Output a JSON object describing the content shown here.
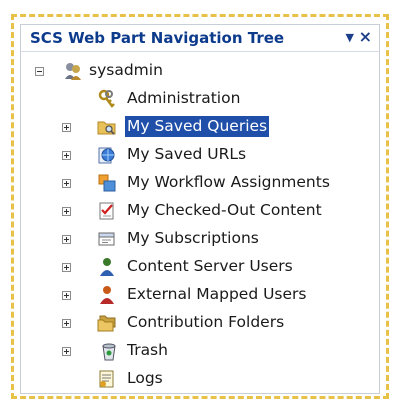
{
  "webpart": {
    "title": "SCS Web Part Navigation Tree",
    "menu_glyph": "▼",
    "close_glyph": "×"
  },
  "tree": {
    "root": {
      "label": "sysadmin",
      "icon": "user-admin-icon",
      "expanded": true
    },
    "items": [
      {
        "label": "Administration",
        "icon": "keys-icon",
        "expandable": false,
        "selected": false
      },
      {
        "label": "My Saved Queries",
        "icon": "folder-search-icon",
        "expandable": true,
        "selected": true
      },
      {
        "label": "My Saved URLs",
        "icon": "globe-link-icon",
        "expandable": true,
        "selected": false
      },
      {
        "label": "My Workflow Assignments",
        "icon": "workflow-icon",
        "expandable": true,
        "selected": false
      },
      {
        "label": "My Checked-Out Content",
        "icon": "checklist-icon",
        "expandable": true,
        "selected": false
      },
      {
        "label": "My Subscriptions",
        "icon": "subscription-icon",
        "expandable": true,
        "selected": false
      },
      {
        "label": "Content Server Users",
        "icon": "user-green-icon",
        "expandable": true,
        "selected": false
      },
      {
        "label": "External Mapped Users",
        "icon": "user-red-icon",
        "expandable": true,
        "selected": false
      },
      {
        "label": "Contribution Folders",
        "icon": "folders-icon",
        "expandable": true,
        "selected": false
      },
      {
        "label": "Trash",
        "icon": "trash-icon",
        "expandable": true,
        "selected": false
      },
      {
        "label": "Logs",
        "icon": "logs-icon",
        "expandable": false,
        "selected": false
      }
    ]
  }
}
